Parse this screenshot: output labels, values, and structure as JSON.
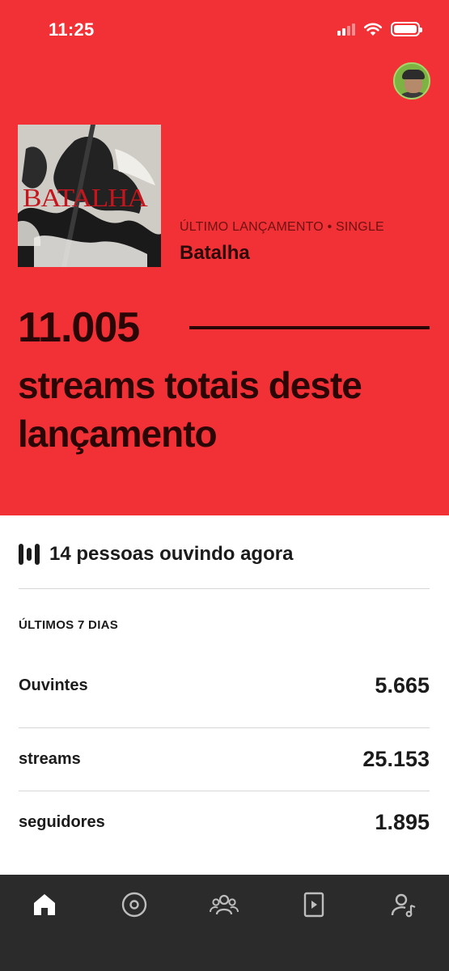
{
  "status_bar": {
    "time": "11:25"
  },
  "colors": {
    "hero_background": "#f23136",
    "hero_text": "#2a0606",
    "nav_background": "#2b2b2b"
  },
  "release": {
    "album_art_title": "BATALHA",
    "label": "ÚLTIMO LANÇAMENTO • SINGLE",
    "name": "Batalha",
    "total_streams": "11.005",
    "total_streams_caption": "streams totais deste lançamento"
  },
  "live": {
    "text": "14 pessoas ouvindo agora"
  },
  "stats": {
    "period_label": "ÚLTIMOS 7 DIAS",
    "rows": [
      {
        "label": "Ouvintes",
        "value": "5.665"
      },
      {
        "label": "streams",
        "value": "25.153"
      },
      {
        "label": "seguidores",
        "value": "1.895"
      }
    ]
  },
  "nav": {
    "items": [
      {
        "icon": "home-icon",
        "active": true
      },
      {
        "icon": "music-disc-icon",
        "active": false
      },
      {
        "icon": "audience-icon",
        "active": false
      },
      {
        "icon": "video-play-icon",
        "active": false
      },
      {
        "icon": "artist-profile-icon",
        "active": false
      }
    ]
  }
}
